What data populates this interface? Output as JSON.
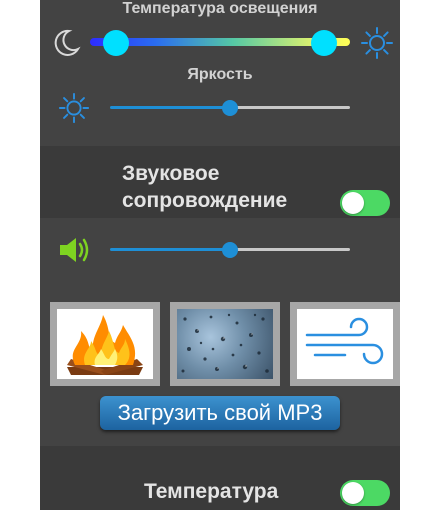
{
  "lighting": {
    "color_temperature_label": "Температура освещения",
    "color_temperature_low": 0.1,
    "color_temperature_high": 0.9,
    "brightness_label": "Яркость",
    "brightness_value": 0.5
  },
  "sound": {
    "title": "Звуковое сопровождение",
    "enabled": true,
    "volume_value": 0.5,
    "presets": [
      {
        "name": "fire-icon"
      },
      {
        "name": "rain-icon"
      },
      {
        "name": "wind-icon"
      }
    ],
    "upload_label": "Загрузить свой MP3"
  },
  "temperature": {
    "title": "Температура",
    "enabled": true
  },
  "colors": {
    "panel": "#434343",
    "panel_dark": "#3a3a3a",
    "accent_blue": "#1e8fd6",
    "knob_cyan": "#00e0ff",
    "toggle_on": "#4cd964",
    "speaker_green": "#7ed321"
  }
}
